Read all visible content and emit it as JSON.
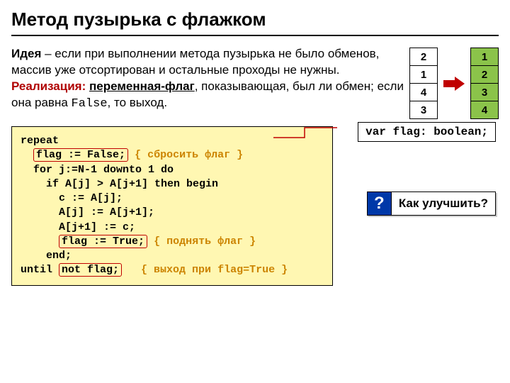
{
  "title": "Метод пузырька с флажком",
  "idea": {
    "label": "Идея",
    "text": " – если при выполнении метода пузырька не было обменов, массив уже отсортирован и остальные проходы не нужны."
  },
  "realization": {
    "label": "Реализация:",
    "underline": "переменная-флаг",
    "text1": ", показывающая, был ли обмен; если она равна ",
    "code_false": "False",
    "text2": ", то выход."
  },
  "arrays": {
    "left": [
      "2",
      "1",
      "4",
      "3"
    ],
    "right": [
      "1",
      "2",
      "3",
      "4"
    ]
  },
  "var_callout": "var flag: boolean;",
  "improve": {
    "q": "?",
    "text": "Как улучшить?"
  },
  "code": {
    "l1": "repeat",
    "l2_box": "flag := False;",
    "l2_comment": "{ сбросить флаг }",
    "l3": "  for j:=N-1 downto 1 do",
    "l4": "    if A[j] > A[j+1] then begin",
    "l5": "      с := A[j];",
    "l6": "      A[j] := A[j+1];",
    "l7": "      A[j+1] := с;",
    "l8_pre": "      ",
    "l8_box": "flag := True;",
    "l8_comment": "{ поднять флаг }",
    "l9": "    end;",
    "l10_pre": "until ",
    "l10_box": "not flag;",
    "l10_comment": "{ выход при flag=True }"
  }
}
